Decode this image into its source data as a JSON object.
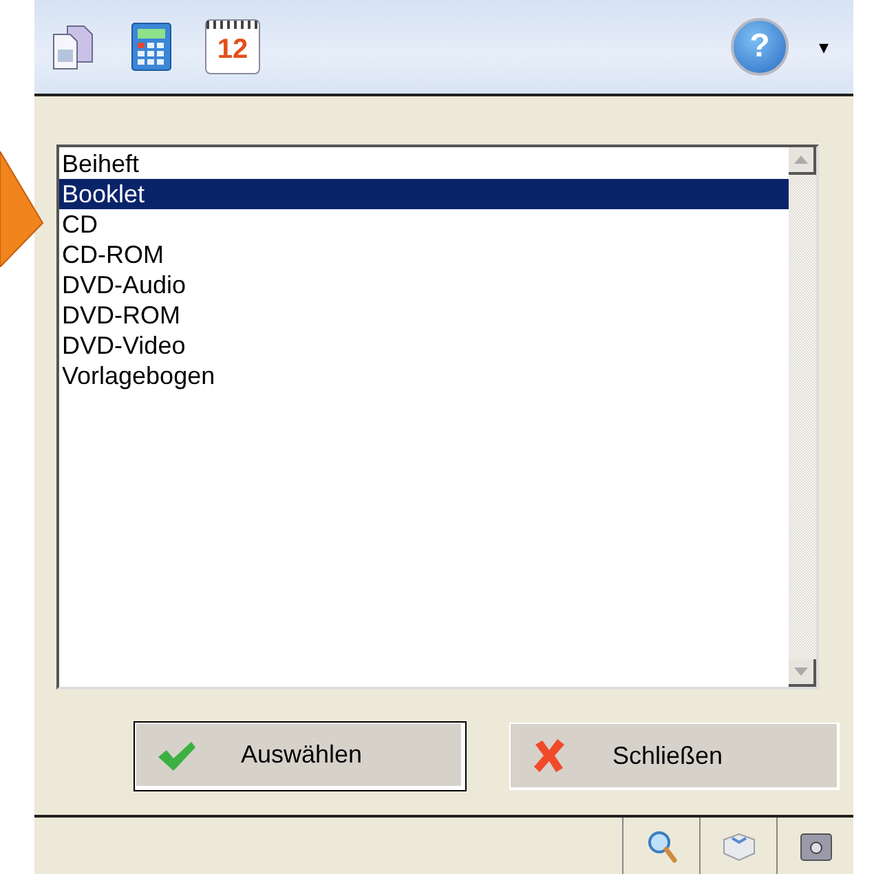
{
  "toolbar": {
    "tools": [
      {
        "kind": "documents"
      },
      {
        "kind": "calculator"
      },
      {
        "kind": "calendar",
        "label": "12"
      }
    ],
    "help": {
      "label": "?",
      "menu_caret": "▾"
    }
  },
  "list": {
    "items": [
      {
        "label": "Beiheft",
        "selected": false
      },
      {
        "label": "Booklet",
        "selected": true
      },
      {
        "label": "CD",
        "selected": false
      },
      {
        "label": "CD-ROM",
        "selected": false
      },
      {
        "label": "DVD-Audio",
        "selected": false
      },
      {
        "label": "DVD-ROM",
        "selected": false
      },
      {
        "label": "DVD-Video",
        "selected": false
      },
      {
        "label": "Vorlagebogen",
        "selected": false
      }
    ]
  },
  "buttons": [
    {
      "kind": "ok",
      "label": "Auswählen",
      "default": true
    },
    {
      "kind": "close",
      "label": "Schließen",
      "default": false
    }
  ],
  "status_bar": {
    "icons": [
      {
        "kind": "search"
      },
      {
        "kind": "box"
      },
      {
        "kind": "camera"
      }
    ]
  }
}
